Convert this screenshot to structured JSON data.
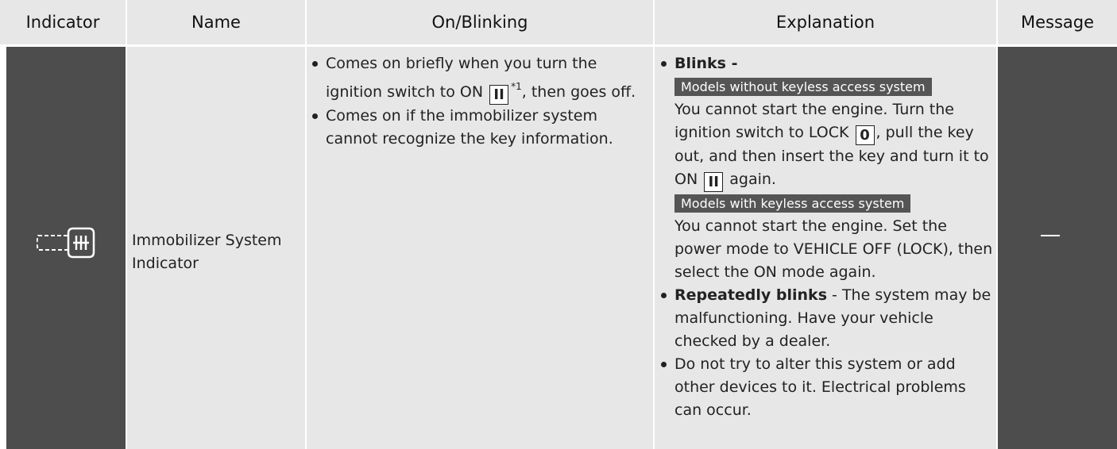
{
  "headers": {
    "indicator": "Indicator",
    "name": "Name",
    "on_blinking": "On/Blinking",
    "explanation": "Explanation",
    "message": "Message"
  },
  "row": {
    "icon": "immobilizer-key-icon",
    "name": "Immobilizer System Indicator",
    "on_blinking": {
      "item1_before": "Comes on briefly when you turn the ignition switch to ON",
      "item1_key": "II",
      "item1_sup": "*1",
      "item1_after": ", then goes off.",
      "item2": "Comes on if the immobilizer system cannot recognize the key information."
    },
    "explanation": {
      "blinks_label": "Blinks -",
      "tag_no_keyless": "Models without keyless access system",
      "no_keyless_p1": "You cannot start the engine. Turn the ignition switch to LOCK",
      "key_lock": "0",
      "no_keyless_p2": ", pull the key out, and then insert the key and turn it to ON",
      "key_on": "II",
      "no_keyless_p3": "again.",
      "tag_keyless": "Models with keyless access system",
      "keyless_text": "You cannot start the engine. Set the power mode to VEHICLE OFF (LOCK), then select the ON mode again.",
      "repeat_label": "Repeatedly blinks",
      "repeat_text": " - The system may be malfunctioning. Have your vehicle checked by a dealer.",
      "alter_text": "Do not try to alter this system or add other devices to it. Electrical problems can occur."
    },
    "message": "—"
  },
  "colors": {
    "header_bg": "#e7e7e7",
    "dark_cell": "#4d4d4d",
    "light_cell": "#e7e7e7",
    "tag_bg": "#555555"
  }
}
